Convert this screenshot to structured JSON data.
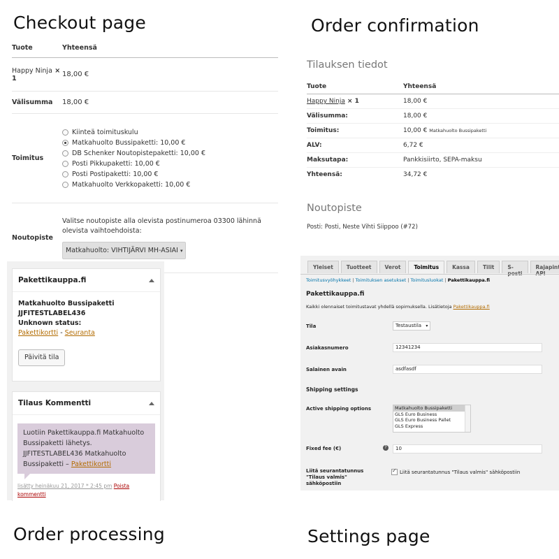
{
  "quadrant_titles": {
    "checkout": "Checkout page",
    "confirmation": "Order confirmation",
    "processing": "Order processing",
    "settings": "Settings page"
  },
  "checkout": {
    "headers": [
      "Tuote",
      "Yhteensä"
    ],
    "product_name": "Happy Ninja",
    "product_qty": "× 1",
    "product_total": "18,00 €",
    "subtotal_label": "Välisumma",
    "subtotal_value": "18,00 €",
    "shipping_label": "Toimitus",
    "shipping_options": [
      "Kiinteä toimituskulu",
      "Matkahuolto Bussipaketti: 10,00 €",
      "DB Schenker Noutopistepaketti: 10,00 €",
      "Posti Pikkupaketti: 10,00 €",
      "Posti Postipaketti: 10,00 €",
      "Matkahuolto Verkkopaketti: 10,00 €"
    ],
    "selected_shipping": 1,
    "pickup_label": "Noutopiste",
    "pickup_text": "Valitse noutopiste alla olevista postinumeroa 03300 lähinnä olevista vaihtoehdoista:",
    "pickup_select": "Matkahuolto: VIHTIJÄRVI MH-ASIAI"
  },
  "processing": {
    "box1_title": "Pakettikauppa.fi",
    "service": "Matkahuolto Bussipaketti",
    "tracking_code": "JJFITESTLABEL436",
    "status": "Unknown status:",
    "link_card": "Pakettikortti",
    "link_sep": " - ",
    "link_track": "Seuranta",
    "update_button": "Päivitä tila",
    "box2_title": "Tilaus Kommentti",
    "note_text": "Luotiin Pakettikauppa.fi Matkahuolto Bussipaketti lähetys. JJFITESTLABEL436 Matkahuolto Bussipaketti –",
    "note_link": "Pakettikortti",
    "note_meta": "lisätty heinäkuu 21, 2017 * 2:45 pm",
    "delete_note": "Poista kommentti"
  },
  "confirmation": {
    "heading": "Tilauksen tiedot",
    "headers": [
      "Tuote",
      "Yhteensä"
    ],
    "product_name": "Happy Ninja",
    "product_qty": "× 1",
    "product_total": "18,00 €",
    "rows": [
      {
        "label": "Välisumma:",
        "value": "18,00 €",
        "extra": ""
      },
      {
        "label": "Toimitus:",
        "value": "10,00 €",
        "extra": "Matkahuolto Bussipaketti"
      },
      {
        "label": "ALV:",
        "value": "6,72 €",
        "extra": ""
      },
      {
        "label": "Maksutapa:",
        "value": "Pankkisiirto, SEPA-maksu",
        "extra": ""
      },
      {
        "label": "Yhteensä:",
        "value": "34,72 €",
        "extra": ""
      }
    ],
    "pickup_heading": "Noutopiste",
    "pickup_text": "Posti: Posti, Neste Vihti Siippoo (#72)"
  },
  "settings": {
    "tabs": [
      "Yleiset",
      "Tuotteet",
      "Verot",
      "Toimitus",
      "Kassa",
      "Tilit",
      "S-posti",
      "Rajapinta API"
    ],
    "active_tab": 3,
    "subnav": [
      "Toimitusvyöhykkeet",
      "Toimituksen asetukset",
      "Toimitusluokat",
      "Pakettikauppa.fi"
    ],
    "section_title": "Pakettikauppa.fi",
    "description": "Kaikki olennaiset toimitustavat yhdellä sopimuksella. Lisätietoja",
    "description_link": "Pakettikauppa.fi",
    "mode_label": "Tila",
    "mode_value": "Testaustila",
    "customer_label": "Asiakasnumero",
    "customer_value": "12341234",
    "secret_label": "Salainen avain",
    "secret_value": "asdfasdf",
    "shipping_settings": "Shipping settings",
    "active_label": "Active shipping options",
    "active_options": [
      "Matkahuolto Bussipaketti",
      "GLS Euro Business",
      "GLS Euro Business Pallet",
      "GLS Express"
    ],
    "fee_label": "Fixed fee (€)",
    "fee_value": "10",
    "tracking_label": "Liitä seurantatunnus \"Tilaus valmis\" sähköpostiin",
    "tracking_checkbox_label": "Liitä seurantatunnus \"Tilaus valmis\" sähköpostiin",
    "tracking_checked": true
  },
  "colors": {
    "link_orange": "#b26b00",
    "note_purple": "#d9ccdb",
    "admin_bg": "#f1f1f1"
  }
}
